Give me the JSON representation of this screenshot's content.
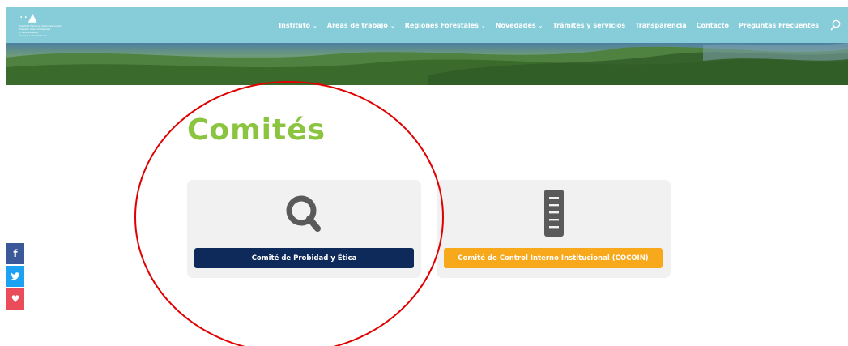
{
  "header": {
    "logo_mark": "··▲",
    "logo_text": "Instituto Nacional de Conservación\nForestal Áreas Protegidas\ny Vida Silvestre\nGobierno de Honduras",
    "nav": [
      {
        "label": "Instituto",
        "has_dropdown": true
      },
      {
        "label": "Áreas de trabajo",
        "has_dropdown": true
      },
      {
        "label": "Regiones Forestales",
        "has_dropdown": true
      },
      {
        "label": "Novedades",
        "has_dropdown": true
      },
      {
        "label": "Trámites y servicios",
        "has_dropdown": false
      },
      {
        "label": "Transparencia",
        "has_dropdown": false
      },
      {
        "label": "Contacto",
        "has_dropdown": false
      },
      {
        "label": "Preguntas Frecuentes",
        "has_dropdown": false
      }
    ],
    "search_icon": "search-icon",
    "dropdown_glyph": "⌄"
  },
  "page": {
    "title": "Comités"
  },
  "cards": [
    {
      "icon": "magnifier-icon",
      "button_label": "Comité de Probidad y Ética",
      "button_color": "#0e2a5a"
    },
    {
      "icon": "document-icon",
      "button_label": "Comité de Control Interno Institucional (COCOIN)",
      "button_color": "#f7a81b"
    }
  ],
  "social": {
    "facebook": "f",
    "twitter": "🐦",
    "pinterest": "♥"
  },
  "colors": {
    "header_bg": "#87cdd9",
    "title_green": "#8bc53f",
    "card_bg": "#f1f1f1",
    "icon_gray": "#5a5a5a",
    "annotation_red": "#e00000"
  }
}
